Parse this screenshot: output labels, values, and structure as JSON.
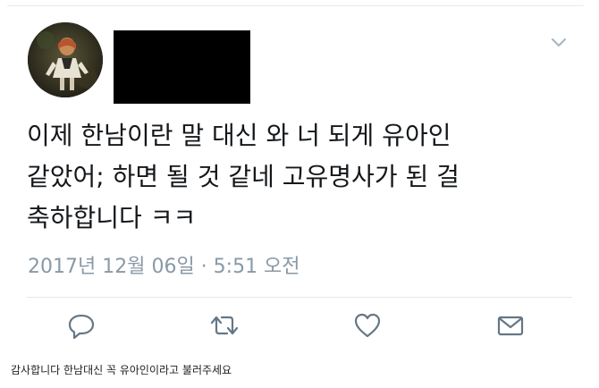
{
  "tweet": {
    "text_lines": [
      "이제 한남이란 말 대신 와 너 되게 유아인",
      "같았어; 하면 될 것 같네 고유명사가 된 걸",
      "축하합니다 ㅋㅋ"
    ],
    "timestamp": "2017년 12월 06일 · 5:51 오전"
  },
  "actions": {
    "icons": [
      "reply-icon",
      "retweet-icon",
      "like-icon",
      "direct-message-icon"
    ]
  },
  "caption": "감사합니다 한남대신 꼭 유아인이라고 불러주세요",
  "colors": {
    "text": "#14171a",
    "muted": "#8899a6",
    "icon": "#657786",
    "divider": "#e1e8ed"
  }
}
